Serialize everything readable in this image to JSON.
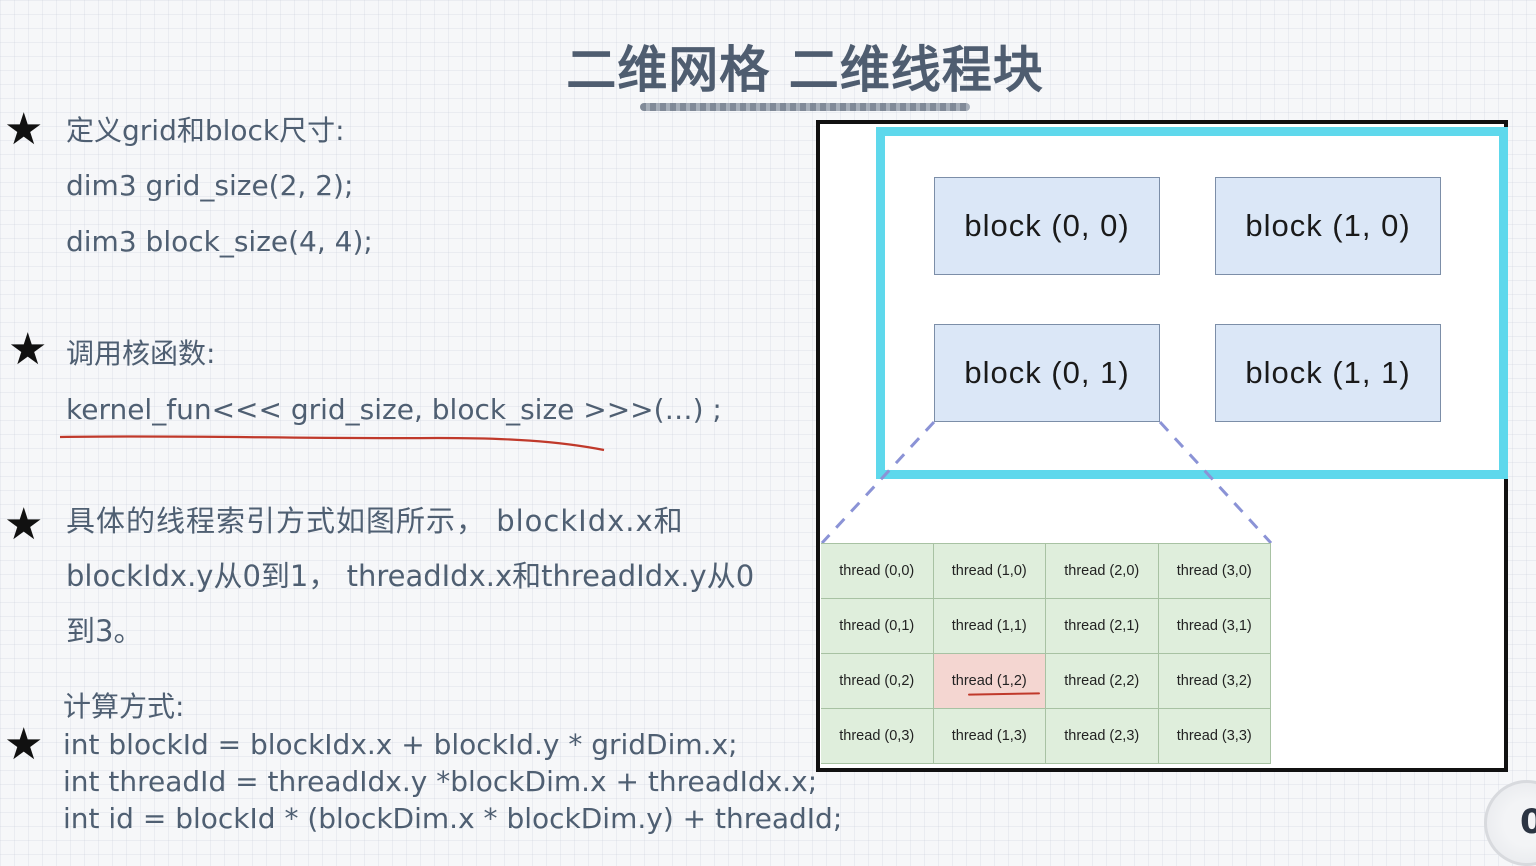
{
  "title": "二维网格 二维线程块",
  "sections": {
    "define": {
      "heading": "定义grid和block尺寸:",
      "line1": "dim3 grid_size(2, 2);",
      "line2": "dim3 block_size(4, 4);"
    },
    "call": {
      "heading": "调用核函数:",
      "line1": "kernel_fun<<< grid_size, block_size >>>(…) ;"
    },
    "index": {
      "line1": "具体的线程索引方式如图所示， blockIdx.x和",
      "line2": "blockIdx.y从0到1， threadIdx.x和threadIdx.y从0",
      "line3": "到3。"
    },
    "compute": {
      "heading": "计算方式:",
      "line1": "int blockId = blockIdx.x + blockId.y * gridDim.x;",
      "line2": "int threadId = threadIdx.y *blockDim.x + threadIdx.x;",
      "line3": "int id = blockId * (blockDim.x * blockDim.y) + threadId;"
    }
  },
  "diagram": {
    "blocks": [
      "block (0, 0)",
      "block (1, 0)",
      "block (0, 1)",
      "block (1, 1)"
    ],
    "threads": [
      "thread (0,0)",
      "thread (1,0)",
      "thread (2,0)",
      "thread (3,0)",
      "thread (0,1)",
      "thread (1,1)",
      "thread (2,1)",
      "thread (3,1)",
      "thread (0,2)",
      "thread (1,2)",
      "thread (2,2)",
      "thread (3,2)",
      "thread (0,3)",
      "thread (1,3)",
      "thread (2,3)",
      "thread (3,3)"
    ],
    "highlighted_thread": "thread (1,2)",
    "colors": {
      "grid_border": "#5ed8ec",
      "block_fill": "#dbe7f7",
      "thread_fill": "#dfeedc",
      "highlight_fill": "#f4d6d1",
      "dash_line": "#8b93d6"
    }
  },
  "corner_mark": "0"
}
